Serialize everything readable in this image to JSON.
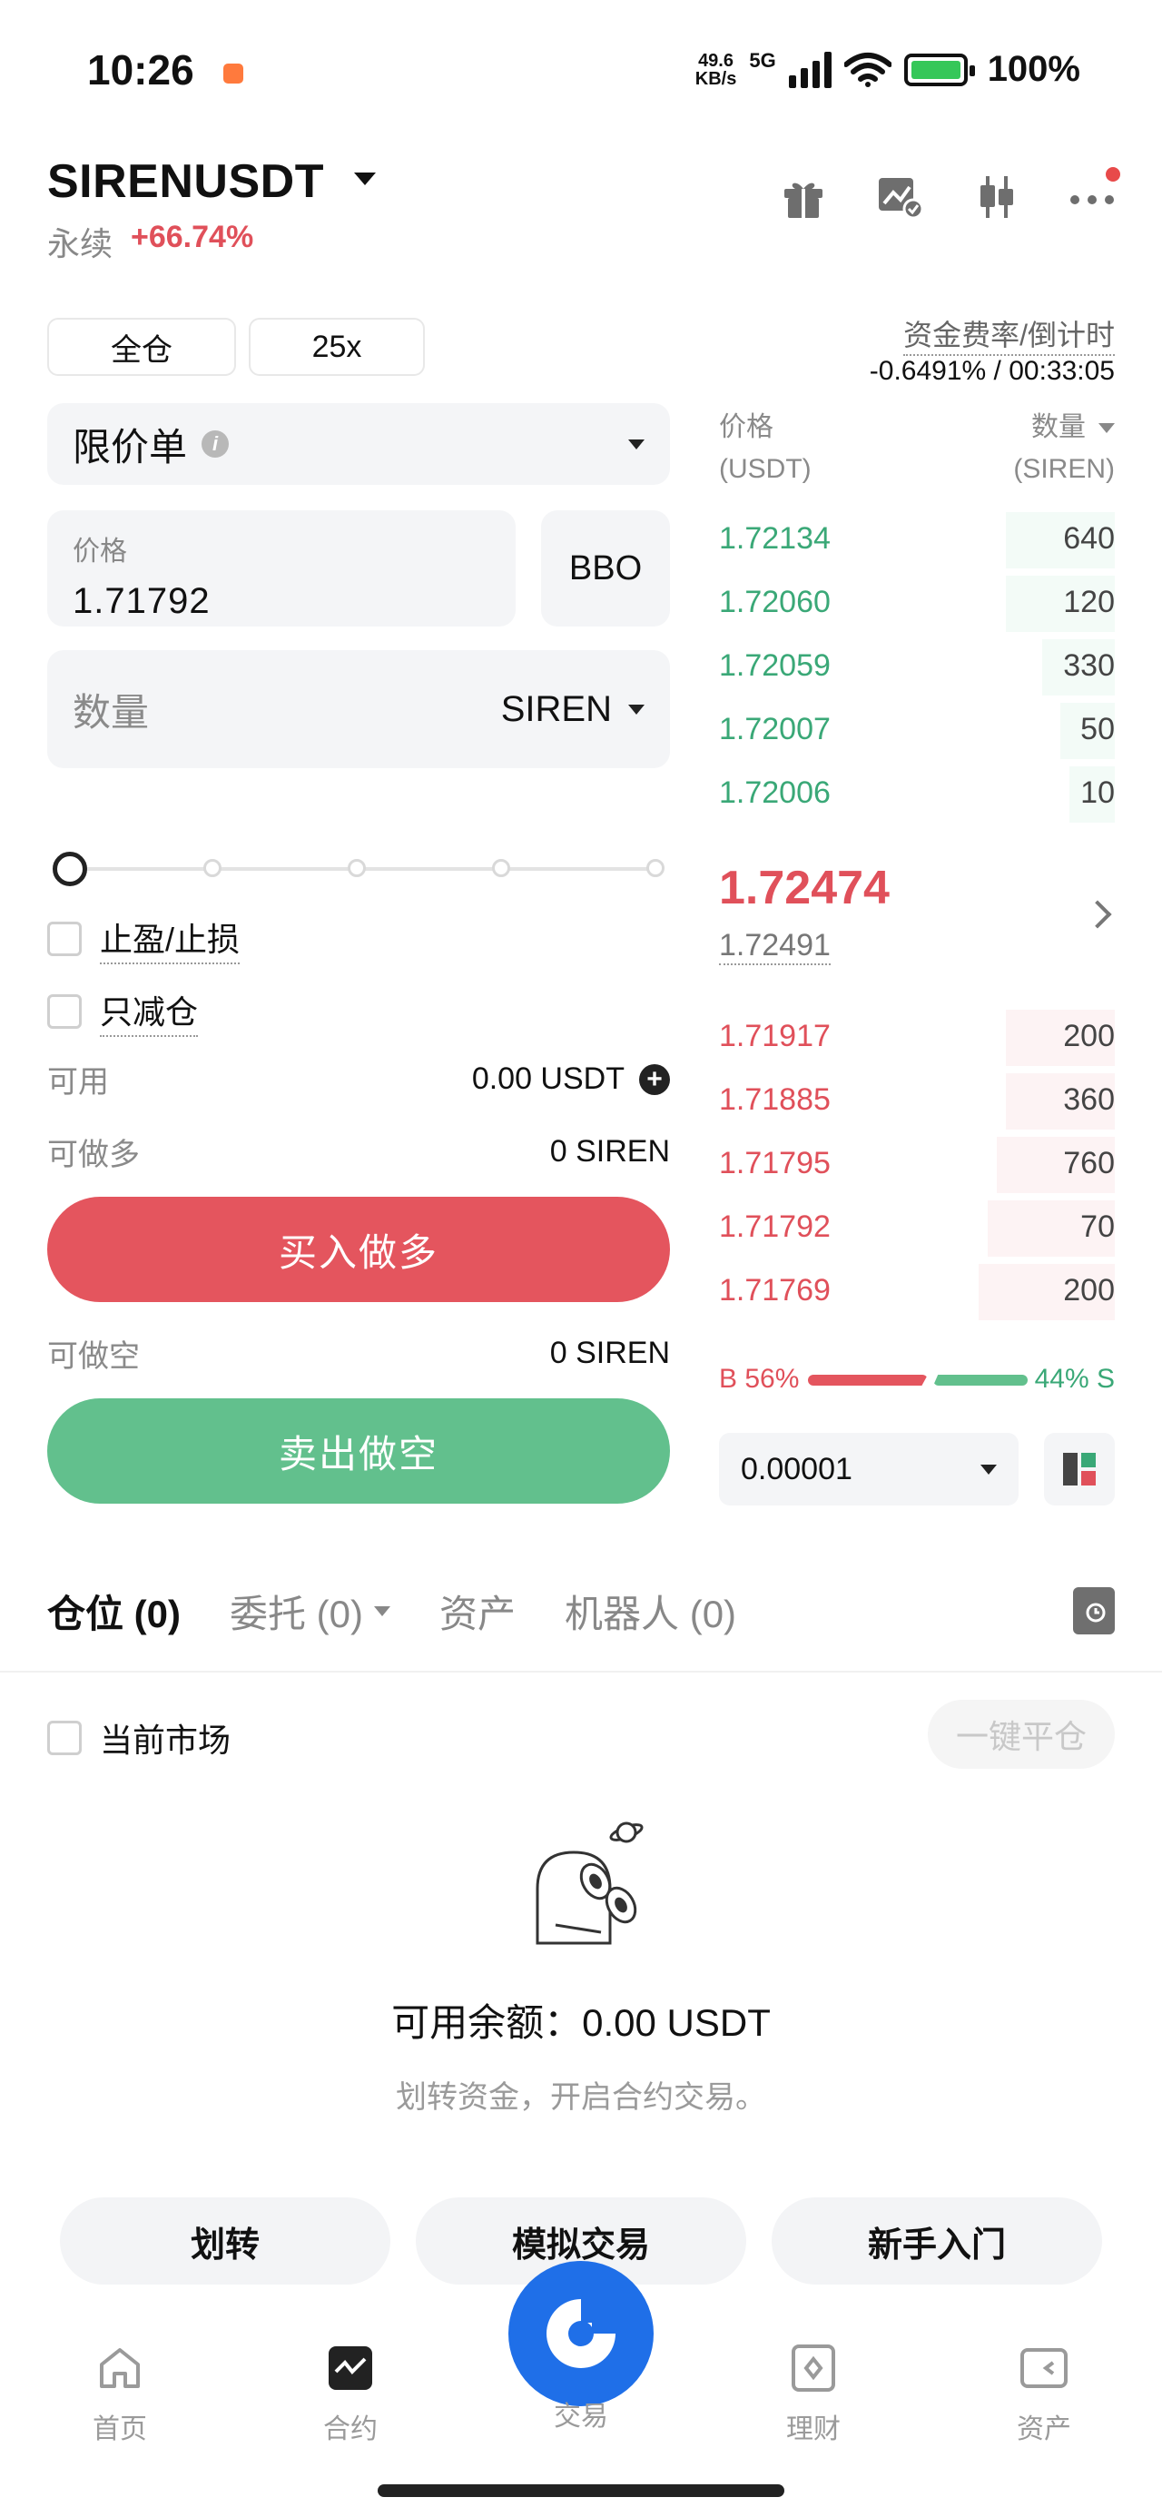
{
  "status_bar": {
    "time": "10:26",
    "speed_value": "49.6",
    "speed_unit": "KB/s",
    "network": "5G",
    "battery": "100%",
    "colors": {
      "battery": "#35c759",
      "notification": "#ff7a3d"
    }
  },
  "header": {
    "symbol": "SIRENUSDT",
    "contract_type": "永续",
    "change": "+66.74%",
    "icons": [
      "gift-icon",
      "chart-check-icon",
      "candlestick-icon",
      "more-icon"
    ]
  },
  "margin": {
    "mode": "全仓",
    "leverage": "25x",
    "funding_label": "资金费率/倒计时",
    "funding_value": "-0.6491% / 00:33:05"
  },
  "form": {
    "order_type": "限价单",
    "price_label": "价格",
    "price_value": "1.71792",
    "bbo_label": "BBO",
    "qty_placeholder": "数量",
    "qty_unit": "SIREN",
    "tpsl_label": "止盈/止损",
    "reduce_only_label": "只减仓",
    "available_label": "可用",
    "available_value": "0.00 USDT",
    "max_long_label": "可做多",
    "max_long_value": "0 SIREN",
    "buy_label": "买入做多",
    "max_short_label": "可做空",
    "max_short_value": "0 SIREN",
    "sell_label": "卖出做空"
  },
  "orderbook": {
    "price_header": "价格",
    "price_unit": "(USDT)",
    "qty_header": "数量",
    "qty_unit": "(SIREN)",
    "asks": [
      {
        "price": "1.72134",
        "qty": "640"
      },
      {
        "price": "1.72060",
        "qty": "120"
      },
      {
        "price": "1.72059",
        "qty": "330"
      },
      {
        "price": "1.72007",
        "qty": "50"
      },
      {
        "price": "1.72006",
        "qty": "10"
      }
    ],
    "last_price": "1.72474",
    "index_price": "1.72491",
    "bids": [
      {
        "price": "1.71917",
        "qty": "200"
      },
      {
        "price": "1.71885",
        "qty": "360"
      },
      {
        "price": "1.71795",
        "qty": "760"
      },
      {
        "price": "1.71792",
        "qty": "70"
      },
      {
        "price": "1.71769",
        "qty": "200"
      }
    ],
    "buy_ratio": "B 56%",
    "sell_ratio": "44% S",
    "tick_size": "0.00001",
    "colors": {
      "ask": "#3aa877",
      "bid": "#e0505a"
    }
  },
  "tabs": {
    "positions": "仓位 (0)",
    "orders": "委托 (0)",
    "assets": "资产",
    "bots": "机器人 (0)"
  },
  "positions_panel": {
    "current_market_label": "当前市场",
    "close_all_label": "一键平仓",
    "available_balance": "可用余额：0.00 USDT",
    "hint": "划转资金，开启合约交易。",
    "buttons": [
      "划转",
      "模拟交易",
      "新手入门"
    ]
  },
  "bottom_nav": {
    "items": [
      "首页",
      "合约",
      "交易",
      "理财",
      "资产"
    ],
    "active": "交易",
    "accent": "#1f6fe8"
  }
}
